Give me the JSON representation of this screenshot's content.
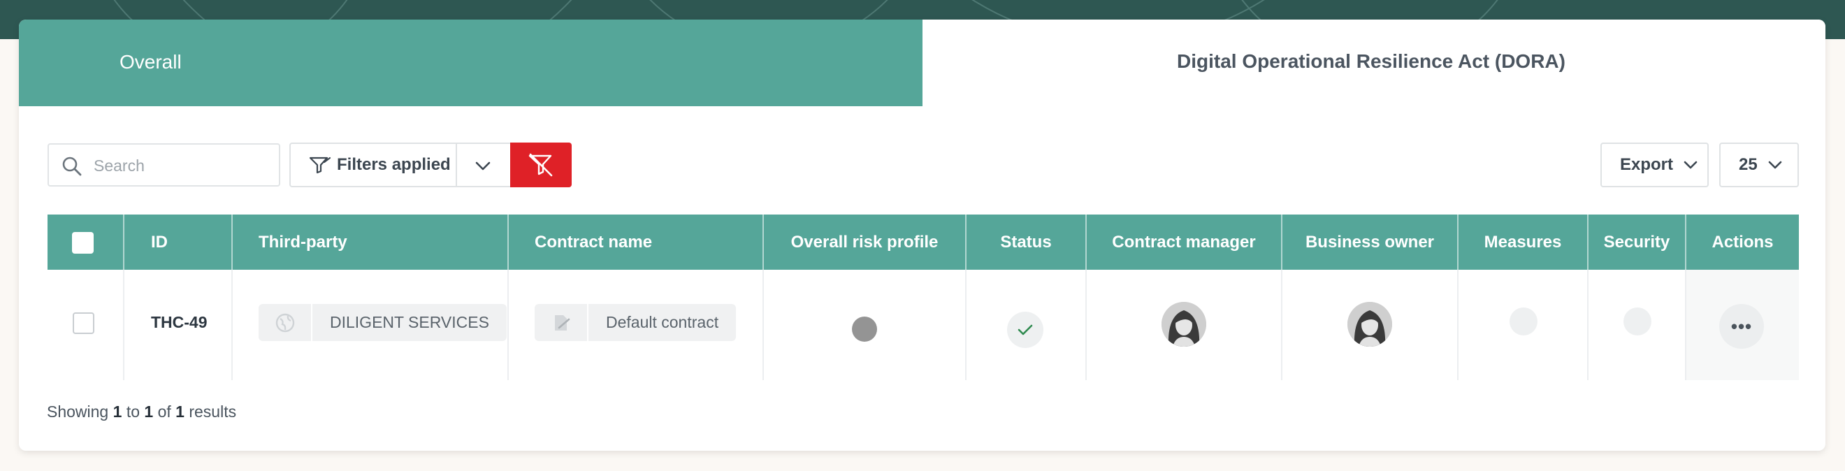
{
  "tabs": {
    "overall": "Overall",
    "dora": "Digital Operational Resilience Act (DORA)"
  },
  "toolbar": {
    "search_placeholder": "Search",
    "filters_label": "Filters applied",
    "export_label": "Export",
    "per_page": "25"
  },
  "table": {
    "columns": [
      "ID",
      "Third-party",
      "Contract name",
      "Overall risk profile",
      "Status",
      "Contract manager",
      "Business owner",
      "Measures",
      "Security",
      "Actions"
    ],
    "rows": [
      {
        "id": "THC-49",
        "third_party": "DILIGENT SERVICES",
        "contract_name": "Default contract"
      }
    ]
  },
  "footer": {
    "prefix": "Showing",
    "from": "1",
    "to_word": "to",
    "to": "1",
    "of_word": "of",
    "total": "1",
    "suffix": "results"
  },
  "colors": {
    "accent": "#55a699",
    "header_band": "#2e5752",
    "clear_filter": "#df2127",
    "status_check": "#2e8a4f"
  },
  "icons": [
    "search-icon",
    "filter-icon",
    "chevron-down-icon",
    "clear-filter-icon",
    "globe-icon",
    "contract-icon",
    "check-icon",
    "more-icon"
  ]
}
